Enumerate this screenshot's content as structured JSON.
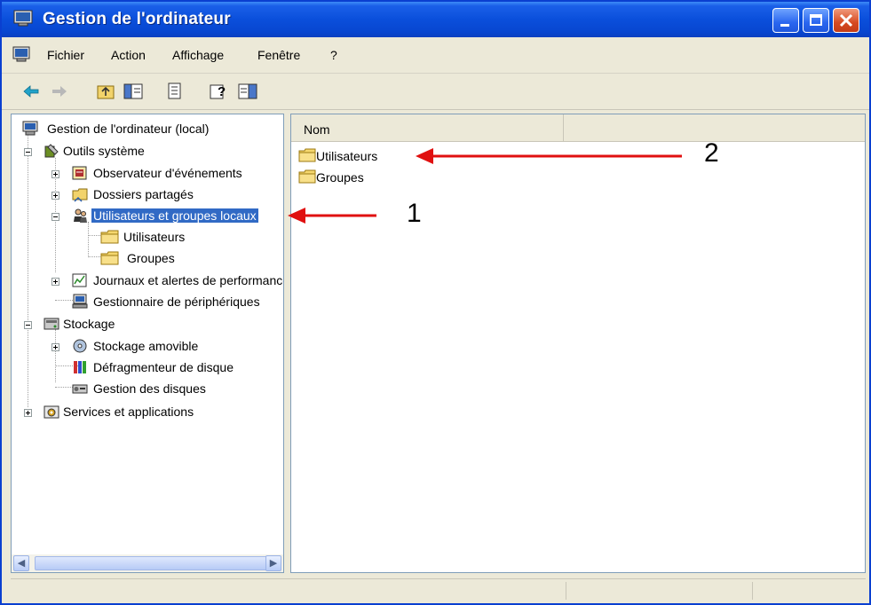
{
  "window": {
    "title": "Gestion de l'ordinateur"
  },
  "menu": [
    "Fichier",
    "Action",
    "Affichage",
    "Fenêtre",
    "?"
  ],
  "tree": {
    "root": "Gestion de l'ordinateur (local)",
    "outils": "Outils système",
    "observateur": "Observateur d'événements",
    "dossiers": "Dossiers partagés",
    "utilisateurs_groupes": "Utilisateurs et groupes locaux",
    "utilisateurs": "Utilisateurs",
    "groupes": "Groupes",
    "journaux": "Journaux et alertes de performance",
    "gestionnaire": "Gestionnaire de périphériques",
    "stockage": "Stockage",
    "stockage_amovible": "Stockage amovible",
    "defrag": "Défragmenteur de disque",
    "gestion_disques": "Gestion des disques",
    "services": "Services et applications"
  },
  "list": {
    "column": "Nom",
    "items": [
      "Utilisateurs",
      "Groupes"
    ]
  },
  "annotations": {
    "a1": "1",
    "a2": "2"
  },
  "colors": {
    "title_bar": "#0a4fdb",
    "selection": "#316ac5",
    "arrow": "#e01010",
    "folder": "#f5d76e"
  }
}
